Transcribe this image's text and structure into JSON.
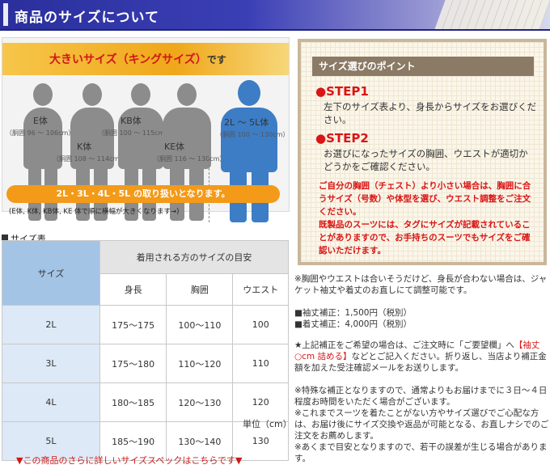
{
  "header": {
    "title": "商品のサイズについて"
  },
  "king": {
    "title_main": "大きいサイズ（キングサイズ）",
    "title_suffix": "です",
    "figures": [
      {
        "name": "E体",
        "range": "（胴囲 96 〜 106cm）"
      },
      {
        "name": "K体",
        "range": "（胴囲 108 〜 114cm）"
      },
      {
        "name": "KB体",
        "range": "（胴囲 100 〜 115cm）"
      },
      {
        "name": "KE体",
        "range": "（胴囲 116 〜 130cm）"
      },
      {
        "name": "2L 〜 5L体",
        "range": "（胴囲 100 〜 130cm）"
      }
    ],
    "order_note": "(E体, K体, KB体, KE 体で順に横幅が大きくなります→)",
    "sizes_available": "2L・3L・4L・5L の取り扱いとなります。"
  },
  "points": {
    "heading": "サイズ選びのポイント",
    "step1_title": "●STEP1",
    "step1_text": "左下のサイズ表より、身長からサイズをお選びください。",
    "step2_title": "●STEP2",
    "step2_text": "お選びになったサイズの胸囲、ウエストが適切かどうかをご確認ください。",
    "note1": "ご自分の胸囲（チェスト）より小さい場合は、胸囲に合うサイズ（号数）や体型を選び、ウエスト調整をご注文ください。",
    "note2": "既製品のスーツには、タグにサイズが記載されていることがありますので、お手持ちのスーツでもサイズをご確認いただけます。"
  },
  "size_table": {
    "caption": "サイズ表",
    "col_size": "サイズ",
    "group_header": "着用される方のサイズの目安",
    "headers": [
      "身長",
      "胸囲",
      "ウエスト"
    ],
    "rows": [
      {
        "size": "2L",
        "height": "175〜175",
        "chest": "100〜110",
        "waist": "100"
      },
      {
        "size": "3L",
        "height": "175〜180",
        "chest": "110〜120",
        "waist": "110"
      },
      {
        "size": "4L",
        "height": "180〜185",
        "chest": "120〜130",
        "waist": "120"
      },
      {
        "size": "5L",
        "height": "185〜190",
        "chest": "130〜140",
        "waist": "130"
      }
    ],
    "unit": "単位（cm）"
  },
  "more_link": "▼この商品のさらに詳しいサイズスペックはこちらです▼",
  "notes": {
    "n1": "※胸囲やウエストは合いそうだけど、身長が合わない場合は、ジャケット袖丈や着丈のお直しにて調整可能です。",
    "sleeve": "■袖丈補正：1,500円（税別）",
    "length": "■着丈補正：4,000円（税別）",
    "n2_a": "★上記補正をご希望の場合は、ご注文時に「ご要望欄」へ",
    "n2_red": "【袖丈○cm 詰める】",
    "n2_b": "などとご記入ください。折り返し、当店より補正金額を加えた受注確認メールをお送りします。",
    "n3": "※特殊な補正となりますので、通常よりもお届けまでに３日〜４日程度お時間をいただく場合がございます。",
    "n4": "※これまでスーツを着たことがない方やサイズ選びでご心配な方は、お届け後にサイズ交換や返品が可能となる、お直しナシでのご注文をお薦めします。",
    "n5": "※あくまで目安となりますので、若干の誤差が生じる場合があります。"
  }
}
